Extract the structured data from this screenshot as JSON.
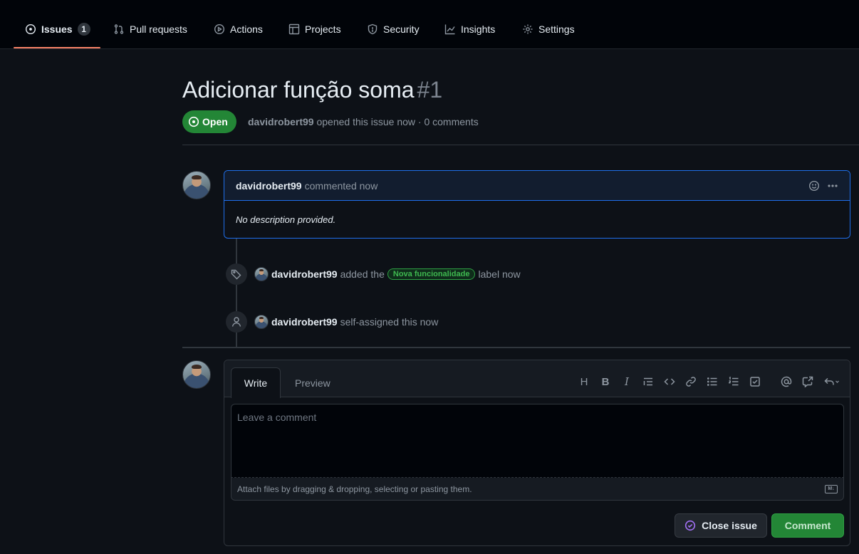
{
  "nav": {
    "tabs": [
      {
        "label": "Issues",
        "icon": "issue-opened-icon",
        "counter": "1",
        "active": true
      },
      {
        "label": "Pull requests",
        "icon": "git-pull-request-icon"
      },
      {
        "label": "Actions",
        "icon": "play-icon"
      },
      {
        "label": "Projects",
        "icon": "table-icon"
      },
      {
        "label": "Security",
        "icon": "shield-icon"
      },
      {
        "label": "Insights",
        "icon": "graph-icon"
      },
      {
        "label": "Settings",
        "icon": "gear-icon"
      }
    ],
    "active_color": "#f78166"
  },
  "issue": {
    "title": "Adicionar função soma",
    "number": "#1",
    "state": "Open",
    "state_color": "#238636",
    "author": "davidrobert99",
    "meta_text": "opened this issue now · 0 comments"
  },
  "comment": {
    "author": "davidrobert99",
    "action": "commented now",
    "body": "No description provided."
  },
  "events": {
    "label_event": {
      "actor": "davidrobert99",
      "text_before": "added the",
      "label": "Nova funcionalidade",
      "text_after": "label now",
      "label_color": "#2ea043"
    },
    "assign_event": {
      "actor": "davidrobert99",
      "text": "self-assigned this now"
    }
  },
  "editor": {
    "tab_write": "Write",
    "tab_preview": "Preview",
    "toolbar": [
      "H",
      "B",
      "I"
    ],
    "placeholder": "Leave a comment",
    "attach_text": "Attach files by dragging & dropping, selecting or pasting them.",
    "markdown_badge": "M↓",
    "close_button": "Close issue",
    "comment_button": "Comment"
  }
}
